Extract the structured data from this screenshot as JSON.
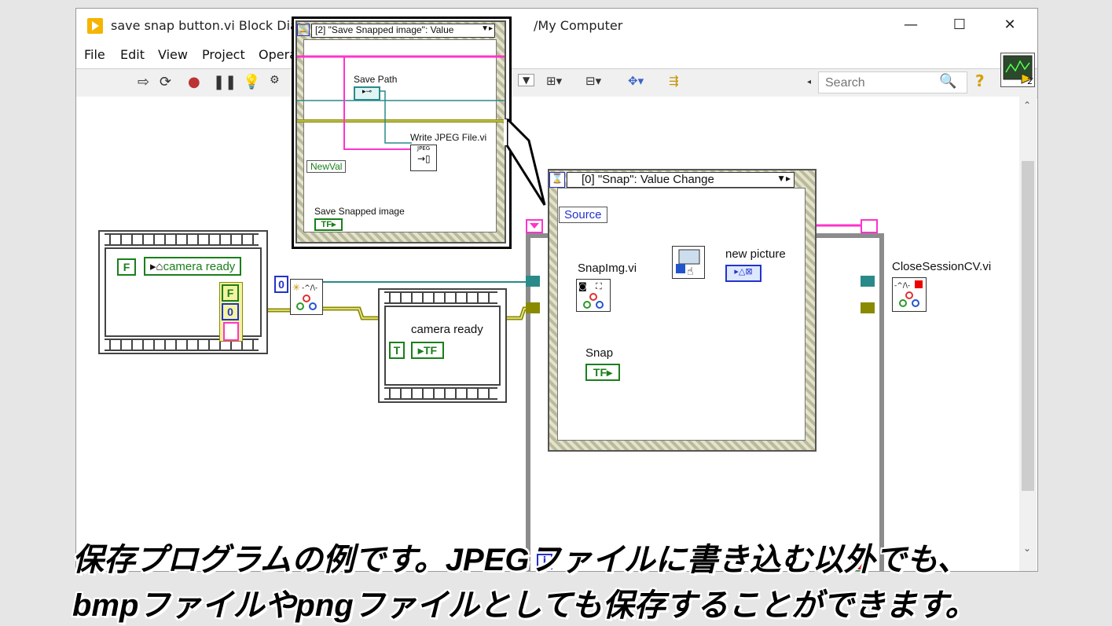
{
  "window": {
    "title": "save snap button.vi Block Diag",
    "title_rest": "/My Computer",
    "controls": {
      "minimize": "—",
      "maximize": "☐",
      "close": "✕"
    }
  },
  "menu": [
    "File",
    "Edit",
    "View",
    "Project",
    "Opera"
  ],
  "search": {
    "placeholder": "Search"
  },
  "connector_pane_number": "2",
  "diagram": {
    "left_loop": {
      "false_const": "F",
      "local_var": "camera ready",
      "indicator_f": "F",
      "indicator_0": "0"
    },
    "numeric_const": "0",
    "middle_loop": {
      "label": "camera ready",
      "true_const": "T"
    },
    "event_structure": {
      "selector": "[0] \"Snap\": Value Change",
      "source_node": "Source",
      "snapimg_label": "SnapImg.vi",
      "snap_button_label": "Snap",
      "snap_tf": "TF",
      "picture_label": "new picture",
      "iter_label": "i"
    },
    "close_label": "CloseSessionCV.vi"
  },
  "popup": {
    "selector": "[2] \"Save Snapped image\": Value",
    "save_path_label": "Save Path",
    "write_jpeg_label": "Write JPEG File.vi",
    "jpeg_tag": "JPEG",
    "newval": "NewVal",
    "save_snapped_label": "Save Snapped image",
    "save_snapped_tf": "TF"
  },
  "caption": {
    "line1": "保存プログラムの例です。JPEGファイルに書き込む以外でも、",
    "line2": "bmpファイルやpngファイルとしても保存することができます。"
  },
  "colors": {
    "boolean": "#1a7f1a",
    "picture": "#ff33cc",
    "refnum": "#2a8a8a",
    "error": "#8a8a00",
    "numeric_int": "#2233cc"
  }
}
